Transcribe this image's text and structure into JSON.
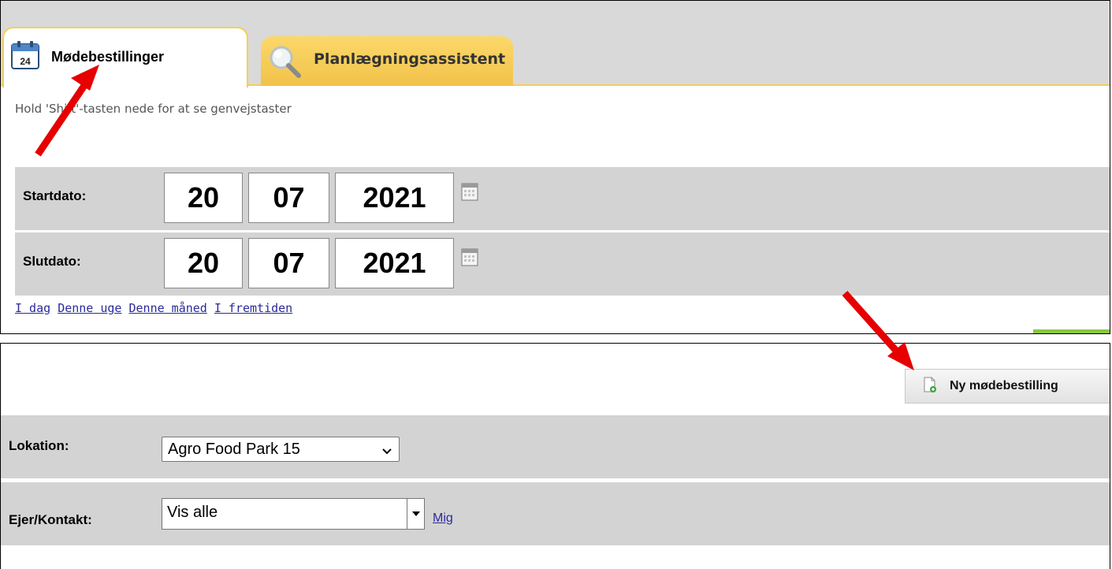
{
  "tabs": [
    {
      "label": "Mødebestillinger",
      "icon": "calendar-icon",
      "icon_text": "24",
      "active": true
    },
    {
      "label": "Planlægningsassistent",
      "icon": "magnifier-icon",
      "active": false
    }
  ],
  "hint": "Hold 'Shift'-tasten nede for at se genvejstaster",
  "start_date": {
    "label": "Startdato:",
    "day": "20",
    "month": "07",
    "year": "2021"
  },
  "end_date": {
    "label": "Slutdato:",
    "day": "20",
    "month": "07",
    "year": "2021"
  },
  "quick_links": [
    "I dag",
    "Denne uge",
    "Denne måned",
    "I fremtiden"
  ],
  "new_booking_button": {
    "label": "Ny mødebestilling",
    "icon": "new-document-icon"
  },
  "location": {
    "label": "Lokation:",
    "selected": "Agro Food Park 15"
  },
  "owner": {
    "label": "Ejer/Kontakt:",
    "value": "Vis alle",
    "link": "Mig"
  },
  "colors": {
    "tab_border": "#f5cf52",
    "row_bg": "#d3d3d3",
    "link": "#2a2a9c",
    "arrow": "#e60000",
    "accent_green": "#8cc63f"
  }
}
